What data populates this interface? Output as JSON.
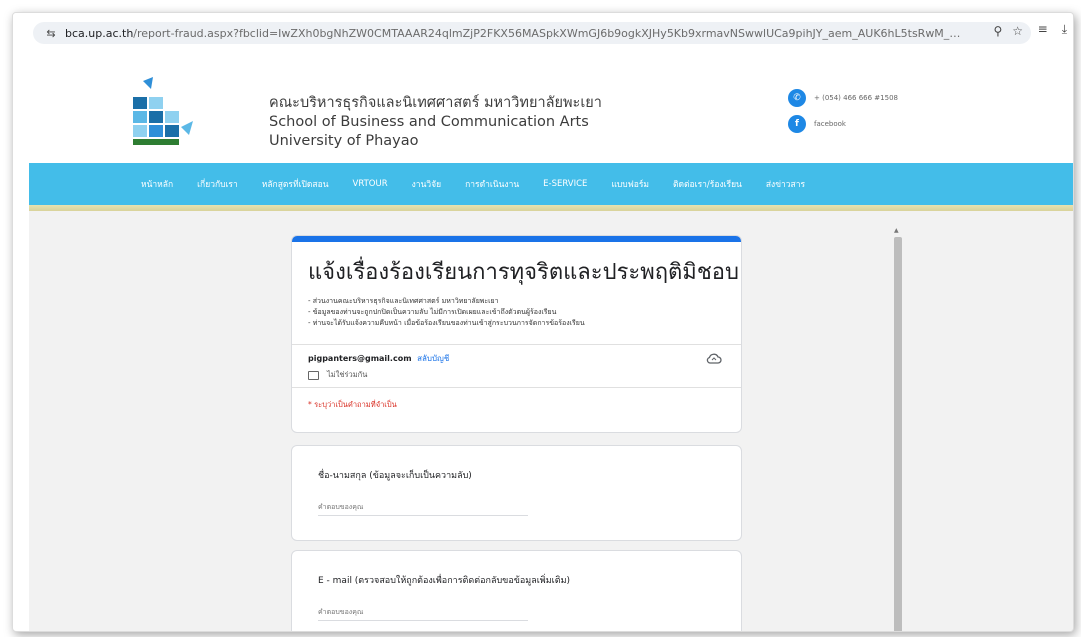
{
  "browser": {
    "url_host": "bca.up.ac.th",
    "url_path": "/report-fraud.aspx?fbclid=IwZXh0bgNhZW0CMTAAAR24qlmZjP2FKX56MASpkXWmGJ6b9ogkXJHy5Kb9xrmavNSwwlUCa9pihJY_aem_AUK6hL5tsRwM_KKo6r5s4gzGhQ75ozly...",
    "zoom_icon": "zoom-icon",
    "star_icon": "star-icon"
  },
  "header": {
    "brand_thai": "คณะบริหารธุรกิจและนิเทศศาสตร์ มหาวิทยาลัยพะเยา",
    "brand_en_1": "School of Business and Communication Arts",
    "brand_en_2": "University of Phayao",
    "phone": "+ (054) 466 666 #1508",
    "facebook": "facebook"
  },
  "nav": {
    "items": [
      "หน้าหลัก",
      "เกี่ยวกับเรา",
      "หลักสูตรที่เปิดสอน",
      "VRTOUR",
      "งานวิจัย",
      "การดำเนินงาน",
      "E-SERVICE",
      "แบบฟอร์ม",
      "ติดต่อเรา/ร้องเรียน",
      "ส่งข่าวสาร"
    ]
  },
  "form": {
    "title": "แจ้งเรื่องร้องเรียนการทุจริตและประพฤติมิชอบ",
    "desc": [
      "- ส่วนงานคณะบริหารธุรกิจและนิเทศศาสตร์ มหาวิทยาลัยพะเยา",
      "- ข้อมูลของท่านจะถูกปกปิดเป็นความลับ ไม่มีการเปิดเผยและเข้าถึงตัวตนผู้ร้องเรียน",
      "- ท่านจะได้รับแจ้งความคืบหน้า เมื่อข้อร้องเรียนของท่านเข้าสู่กระบวนการจัดการข้อร้องเรียน"
    ],
    "account_email": "pigpanters@gmail.com",
    "switch_account": "สลับบัญชี",
    "not_shared": "ไม่ใช่ร่วมกัน",
    "required_note": "* ระบุว่าเป็นคำถามที่จำเป็น",
    "questions": [
      {
        "label": "ชื่อ-นามสกุล (ข้อมูลจะเก็บเป็นความลับ)",
        "placeholder": "คำตอบของคุณ"
      },
      {
        "label": "E - mail  (ตรวจสอบให้ถูกต้องเพื่อการติดต่อกลับขอข้อมูลเพิ่มเติม)",
        "placeholder": "คำตอบของคุณ"
      }
    ]
  },
  "colors": {
    "nav_bg": "#43bde9",
    "accent": "#1a73e8",
    "required": "#d93025"
  }
}
